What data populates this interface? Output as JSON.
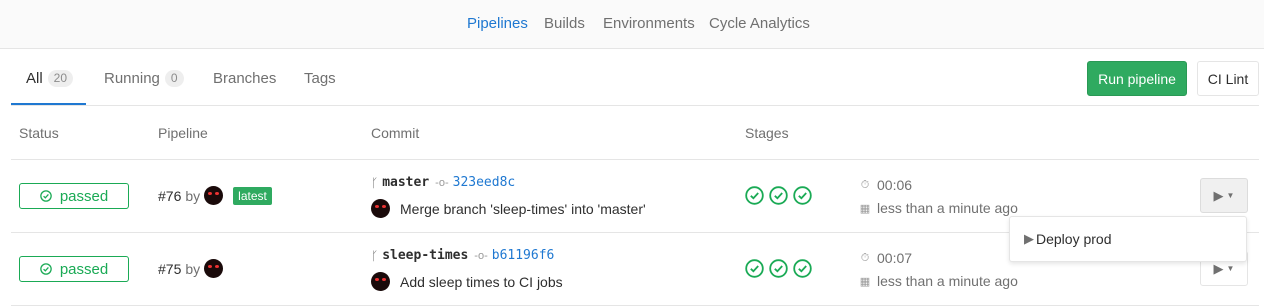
{
  "subnav": {
    "items": [
      {
        "label": "Pipelines",
        "active": true
      },
      {
        "label": "Builds",
        "active": false
      },
      {
        "label": "Environments",
        "active": false
      },
      {
        "label": "Cycle Analytics",
        "active": false
      }
    ]
  },
  "tabs": [
    {
      "label": "All",
      "count": "20",
      "active": true
    },
    {
      "label": "Running",
      "count": "0",
      "active": false
    },
    {
      "label": "Branches",
      "count": null,
      "active": false
    },
    {
      "label": "Tags",
      "count": null,
      "active": false
    }
  ],
  "actions": {
    "run_pipeline": "Run pipeline",
    "ci_lint": "CI Lint"
  },
  "table": {
    "headers": [
      "Status",
      "Pipeline",
      "Commit",
      "Stages"
    ],
    "rows": [
      {
        "status": "passed",
        "pipeline_id": "#76",
        "by": "by",
        "latest_label": "latest",
        "branch": "master",
        "sha": "323eed8c",
        "commit_title": "Merge branch 'sleep-times' into 'master'",
        "stages": [
          "passed",
          "passed",
          "passed"
        ],
        "duration": "00:06",
        "finished": "less than a minute ago"
      },
      {
        "status": "passed",
        "pipeline_id": "#75",
        "by": "by",
        "latest_label": null,
        "branch": "sleep-times",
        "sha": "b61196f6",
        "commit_title": "Add sleep times to CI jobs",
        "stages": [
          "passed",
          "passed",
          "passed"
        ],
        "duration": "00:07",
        "finished": "less than a minute ago"
      }
    ]
  },
  "dropdown": {
    "items": [
      "Deploy prod"
    ]
  },
  "colors": {
    "accent": "#1f78d1",
    "success": "#1aaa55",
    "success_button": "#2faa60"
  },
  "icons": {
    "status": "check-circle-icon",
    "branch": "branch-icon",
    "commit": "commit-icon",
    "duration": "timer-icon",
    "date": "calendar-icon",
    "play": "play-icon"
  }
}
